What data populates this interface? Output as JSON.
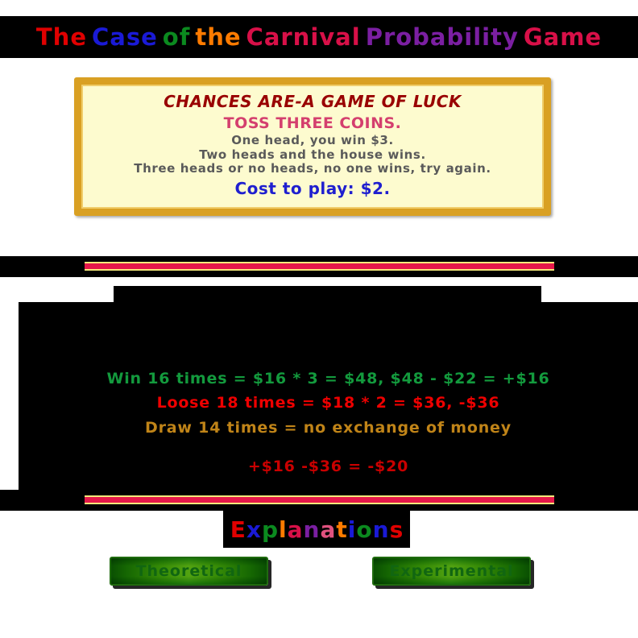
{
  "page": {
    "background_color": "#ffffff",
    "panel_color": "#000000"
  },
  "title": {
    "full_text": "The Case of the Carnival Probability Game",
    "words": [
      {
        "text": "The",
        "color": "#e00000"
      },
      {
        "text": "Case",
        "color": "#1a1ad6"
      },
      {
        "text": "of",
        "color": "#0b8a1f"
      },
      {
        "text": "the",
        "color": "#ff7b00"
      },
      {
        "text": "Carnival",
        "color": "#d81048"
      },
      {
        "text": "Probability",
        "color": "#7b1fa2"
      },
      {
        "text": "Game",
        "color": "#d81048"
      }
    ]
  },
  "rules_card": {
    "background_color": "#fdfbcf",
    "border_color": "#d9a023",
    "headline": "CHANCES ARE-A GAME OF LUCK",
    "headline_color": "#990000",
    "subheadline": "TOSS THREE COINS.",
    "subheadline_color": "#d43f6e",
    "body_lines": [
      "One head, you win $3.",
      "Two heads and the house wins.",
      "Three heads or no heads, no one wins, try again."
    ],
    "body_color": "#5a5a5a",
    "cost_line": "Cost to play: $2.",
    "cost_color": "#1f1fcf"
  },
  "divider": {
    "bar_color": "#e5184a",
    "edge_color": "#f5e97a"
  },
  "results": {
    "win": {
      "text": "Win 16 times = $16 * 3 = $48, $48 - $22 = +$16",
      "color": "#139a3d"
    },
    "loose": {
      "text": "Loose 18 times = $18 * 2 = $36, -$36",
      "color": "#ee0000"
    },
    "draw": {
      "text": "Draw 14 times = no exchange of money",
      "color": "#c08418"
    },
    "total": {
      "text": "+$16 -$36 = -$20",
      "color": "#c90000"
    }
  },
  "explanations": {
    "full_text": "Explanations",
    "letters": [
      {
        "char": "E",
        "color": "#e00000"
      },
      {
        "char": "x",
        "color": "#1a1ad6"
      },
      {
        "char": "p",
        "color": "#0b8a1f"
      },
      {
        "char": "l",
        "color": "#ff7b00"
      },
      {
        "char": "a",
        "color": "#d81048"
      },
      {
        "char": "n",
        "color": "#7b1fa2"
      },
      {
        "char": "a",
        "color": "#e0527f"
      },
      {
        "char": "t",
        "color": "#ff7b00"
      },
      {
        "char": "i",
        "color": "#1a1ad6"
      },
      {
        "char": "o",
        "color": "#0b8a1f"
      },
      {
        "char": "n",
        "color": "#1a1ad6"
      },
      {
        "char": "s",
        "color": "#e00000"
      }
    ]
  },
  "buttons": {
    "theoretical": "Theoretical",
    "experimental": "Experimental",
    "face_color": "#57a81c",
    "highlight_color": "#f2f79a",
    "text_color": "#116611"
  }
}
